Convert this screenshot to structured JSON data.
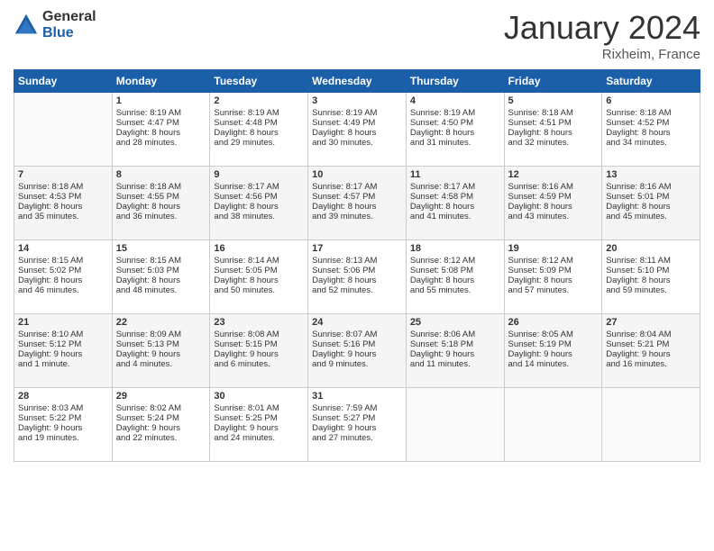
{
  "logo": {
    "general": "General",
    "blue": "Blue"
  },
  "header": {
    "title": "January 2024",
    "location": "Rixheim, France"
  },
  "days": [
    "Sunday",
    "Monday",
    "Tuesday",
    "Wednesday",
    "Thursday",
    "Friday",
    "Saturday"
  ],
  "weeks": [
    [
      {
        "day": "",
        "content": ""
      },
      {
        "day": "1",
        "content": "Sunrise: 8:19 AM\nSunset: 4:47 PM\nDaylight: 8 hours\nand 28 minutes."
      },
      {
        "day": "2",
        "content": "Sunrise: 8:19 AM\nSunset: 4:48 PM\nDaylight: 8 hours\nand 29 minutes."
      },
      {
        "day": "3",
        "content": "Sunrise: 8:19 AM\nSunset: 4:49 PM\nDaylight: 8 hours\nand 30 minutes."
      },
      {
        "day": "4",
        "content": "Sunrise: 8:19 AM\nSunset: 4:50 PM\nDaylight: 8 hours\nand 31 minutes."
      },
      {
        "day": "5",
        "content": "Sunrise: 8:18 AM\nSunset: 4:51 PM\nDaylight: 8 hours\nand 32 minutes."
      },
      {
        "day": "6",
        "content": "Sunrise: 8:18 AM\nSunset: 4:52 PM\nDaylight: 8 hours\nand 34 minutes."
      }
    ],
    [
      {
        "day": "7",
        "content": "Sunrise: 8:18 AM\nSunset: 4:53 PM\nDaylight: 8 hours\nand 35 minutes."
      },
      {
        "day": "8",
        "content": "Sunrise: 8:18 AM\nSunset: 4:55 PM\nDaylight: 8 hours\nand 36 minutes."
      },
      {
        "day": "9",
        "content": "Sunrise: 8:17 AM\nSunset: 4:56 PM\nDaylight: 8 hours\nand 38 minutes."
      },
      {
        "day": "10",
        "content": "Sunrise: 8:17 AM\nSunset: 4:57 PM\nDaylight: 8 hours\nand 39 minutes."
      },
      {
        "day": "11",
        "content": "Sunrise: 8:17 AM\nSunset: 4:58 PM\nDaylight: 8 hours\nand 41 minutes."
      },
      {
        "day": "12",
        "content": "Sunrise: 8:16 AM\nSunset: 4:59 PM\nDaylight: 8 hours\nand 43 minutes."
      },
      {
        "day": "13",
        "content": "Sunrise: 8:16 AM\nSunset: 5:01 PM\nDaylight: 8 hours\nand 45 minutes."
      }
    ],
    [
      {
        "day": "14",
        "content": "Sunrise: 8:15 AM\nSunset: 5:02 PM\nDaylight: 8 hours\nand 46 minutes."
      },
      {
        "day": "15",
        "content": "Sunrise: 8:15 AM\nSunset: 5:03 PM\nDaylight: 8 hours\nand 48 minutes."
      },
      {
        "day": "16",
        "content": "Sunrise: 8:14 AM\nSunset: 5:05 PM\nDaylight: 8 hours\nand 50 minutes."
      },
      {
        "day": "17",
        "content": "Sunrise: 8:13 AM\nSunset: 5:06 PM\nDaylight: 8 hours\nand 52 minutes."
      },
      {
        "day": "18",
        "content": "Sunrise: 8:12 AM\nSunset: 5:08 PM\nDaylight: 8 hours\nand 55 minutes."
      },
      {
        "day": "19",
        "content": "Sunrise: 8:12 AM\nSunset: 5:09 PM\nDaylight: 8 hours\nand 57 minutes."
      },
      {
        "day": "20",
        "content": "Sunrise: 8:11 AM\nSunset: 5:10 PM\nDaylight: 8 hours\nand 59 minutes."
      }
    ],
    [
      {
        "day": "21",
        "content": "Sunrise: 8:10 AM\nSunset: 5:12 PM\nDaylight: 9 hours\nand 1 minute."
      },
      {
        "day": "22",
        "content": "Sunrise: 8:09 AM\nSunset: 5:13 PM\nDaylight: 9 hours\nand 4 minutes."
      },
      {
        "day": "23",
        "content": "Sunrise: 8:08 AM\nSunset: 5:15 PM\nDaylight: 9 hours\nand 6 minutes."
      },
      {
        "day": "24",
        "content": "Sunrise: 8:07 AM\nSunset: 5:16 PM\nDaylight: 9 hours\nand 9 minutes."
      },
      {
        "day": "25",
        "content": "Sunrise: 8:06 AM\nSunset: 5:18 PM\nDaylight: 9 hours\nand 11 minutes."
      },
      {
        "day": "26",
        "content": "Sunrise: 8:05 AM\nSunset: 5:19 PM\nDaylight: 9 hours\nand 14 minutes."
      },
      {
        "day": "27",
        "content": "Sunrise: 8:04 AM\nSunset: 5:21 PM\nDaylight: 9 hours\nand 16 minutes."
      }
    ],
    [
      {
        "day": "28",
        "content": "Sunrise: 8:03 AM\nSunset: 5:22 PM\nDaylight: 9 hours\nand 19 minutes."
      },
      {
        "day": "29",
        "content": "Sunrise: 8:02 AM\nSunset: 5:24 PM\nDaylight: 9 hours\nand 22 minutes."
      },
      {
        "day": "30",
        "content": "Sunrise: 8:01 AM\nSunset: 5:25 PM\nDaylight: 9 hours\nand 24 minutes."
      },
      {
        "day": "31",
        "content": "Sunrise: 7:59 AM\nSunset: 5:27 PM\nDaylight: 9 hours\nand 27 minutes."
      },
      {
        "day": "",
        "content": ""
      },
      {
        "day": "",
        "content": ""
      },
      {
        "day": "",
        "content": ""
      }
    ]
  ]
}
